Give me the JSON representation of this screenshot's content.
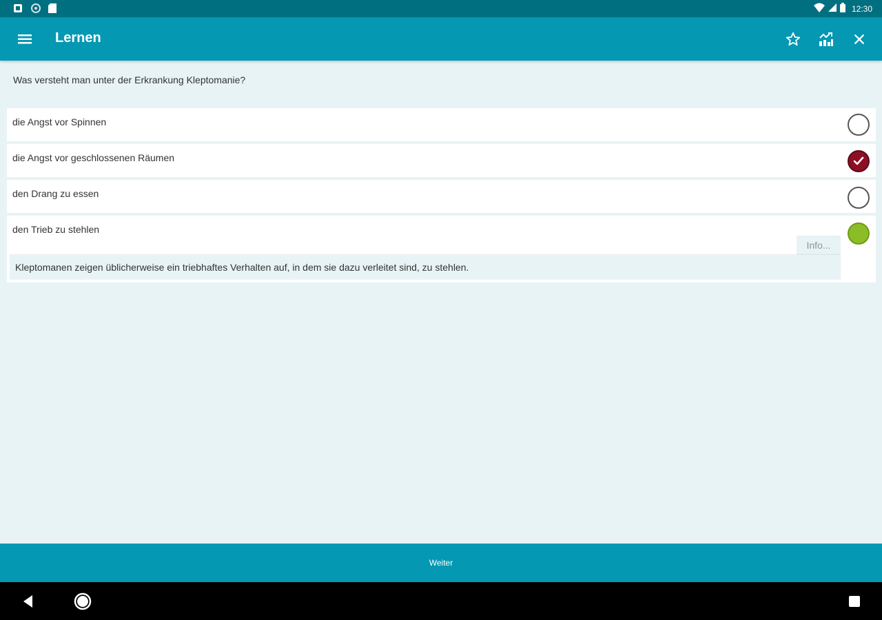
{
  "status_bar": {
    "time": "12:30",
    "left_icons": [
      "notification-icon",
      "sync-icon",
      "sd-card-icon"
    ],
    "right_icons": [
      "wifi-icon",
      "signal-icon",
      "battery-icon"
    ]
  },
  "app_bar": {
    "title": "Lernen",
    "actions": [
      "star-icon",
      "stats-icon",
      "close-icon"
    ]
  },
  "question": "Was versteht man unter der Erkrankung Kleptomanie?",
  "answers": [
    {
      "label": "die Angst vor Spinnen",
      "state": "unselected"
    },
    {
      "label": "die Angst vor geschlossenen Räumen",
      "state": "selected-wrong"
    },
    {
      "label": "den Drang zu essen",
      "state": "unselected"
    },
    {
      "label": "den Trieb zu stehlen",
      "state": "correct"
    }
  ],
  "info": {
    "button_label": "Info...",
    "text": "Kleptomanen zeigen üblicherweise ein triebhaftes Verhalten auf, in dem sie dazu verleitet sind, zu stehlen."
  },
  "bottom_button": "Weiter",
  "colors": {
    "primary": "#0598b3",
    "status_bar": "#006f80",
    "background": "#e8f3f5",
    "wrong": "#8e0e24",
    "correct": "#8dbd26"
  }
}
